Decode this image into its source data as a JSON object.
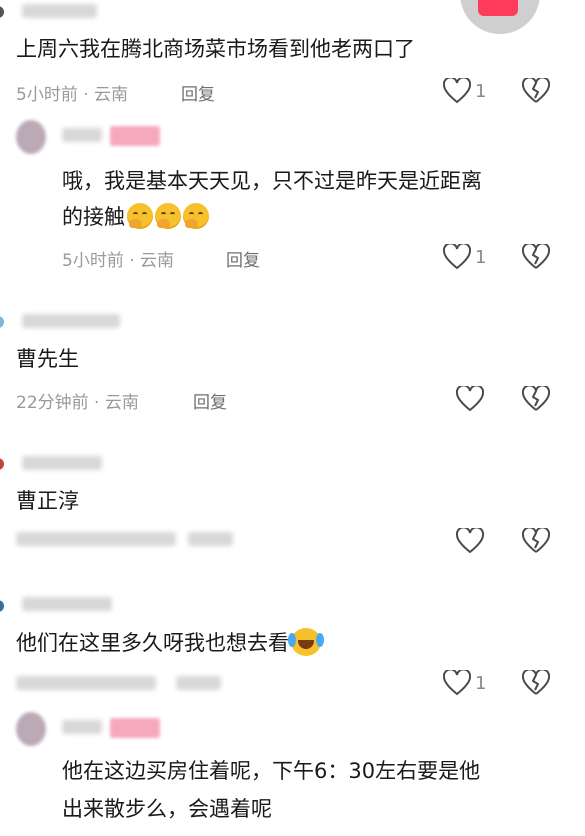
{
  "comments": [
    {
      "text": "上周六我在腾北商场菜市场看到他老两口了",
      "meta": "5小时前 · 云南",
      "reply": "回复",
      "likes": "1"
    },
    {
      "text_line1": "哦，我是基本天天见，只不过是昨天是近距离",
      "text_line2": "的接触",
      "meta": "5小时前 · 云南",
      "reply": "回复",
      "likes": "1"
    },
    {
      "text": "曹先生",
      "meta": "22分钟前 · 云南",
      "reply": "回复",
      "likes": ""
    },
    {
      "text": "曹正淳",
      "meta": "",
      "reply": "",
      "likes": ""
    },
    {
      "text": "他们在这里多久呀我也想去看",
      "meta": "",
      "reply": "",
      "likes": "1"
    },
    {
      "text_line1": "他在这边买房住着呢，下午6：30左右要是他",
      "text_line2": "出来散步么，会遇着呢"
    }
  ]
}
